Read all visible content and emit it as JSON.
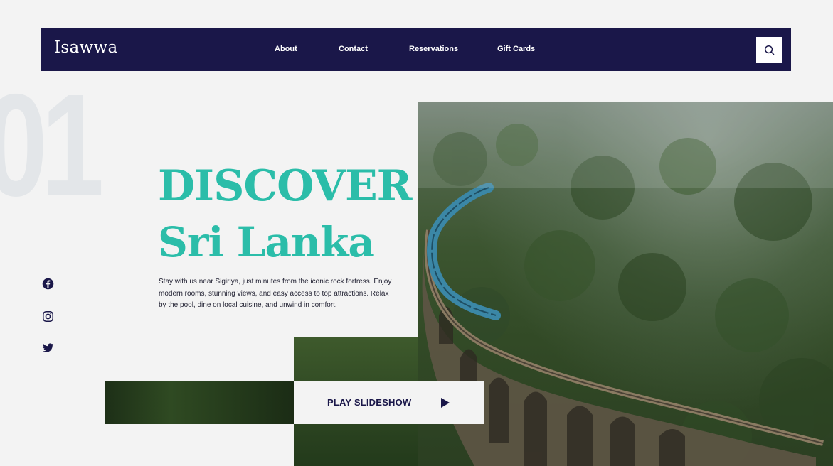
{
  "brand": "Isawwa",
  "nav": {
    "items": [
      "About",
      "Contact",
      "Reservations",
      "Gift Cards"
    ]
  },
  "search_icon": "search-icon",
  "hero": {
    "number": "01",
    "title_line1": "DISCOVER",
    "title_line2": "Sri Lanka",
    "description": "Stay with us near Sigiriya, just minutes from the iconic rock fortress. Enjoy modern rooms, stunning views, and easy access to top attractions. Relax by the pool, dine on local cuisine, and unwind in comfort."
  },
  "cta": {
    "label": "PLAY SLIDESHOW",
    "icon": "play-icon"
  },
  "social": [
    "facebook-icon",
    "instagram-icon",
    "twitter-icon"
  ],
  "colors": {
    "navy": "#1a1749",
    "accent": "#2bbda9",
    "background": "#f3f3f3",
    "big_number": "#e3e6e9"
  }
}
